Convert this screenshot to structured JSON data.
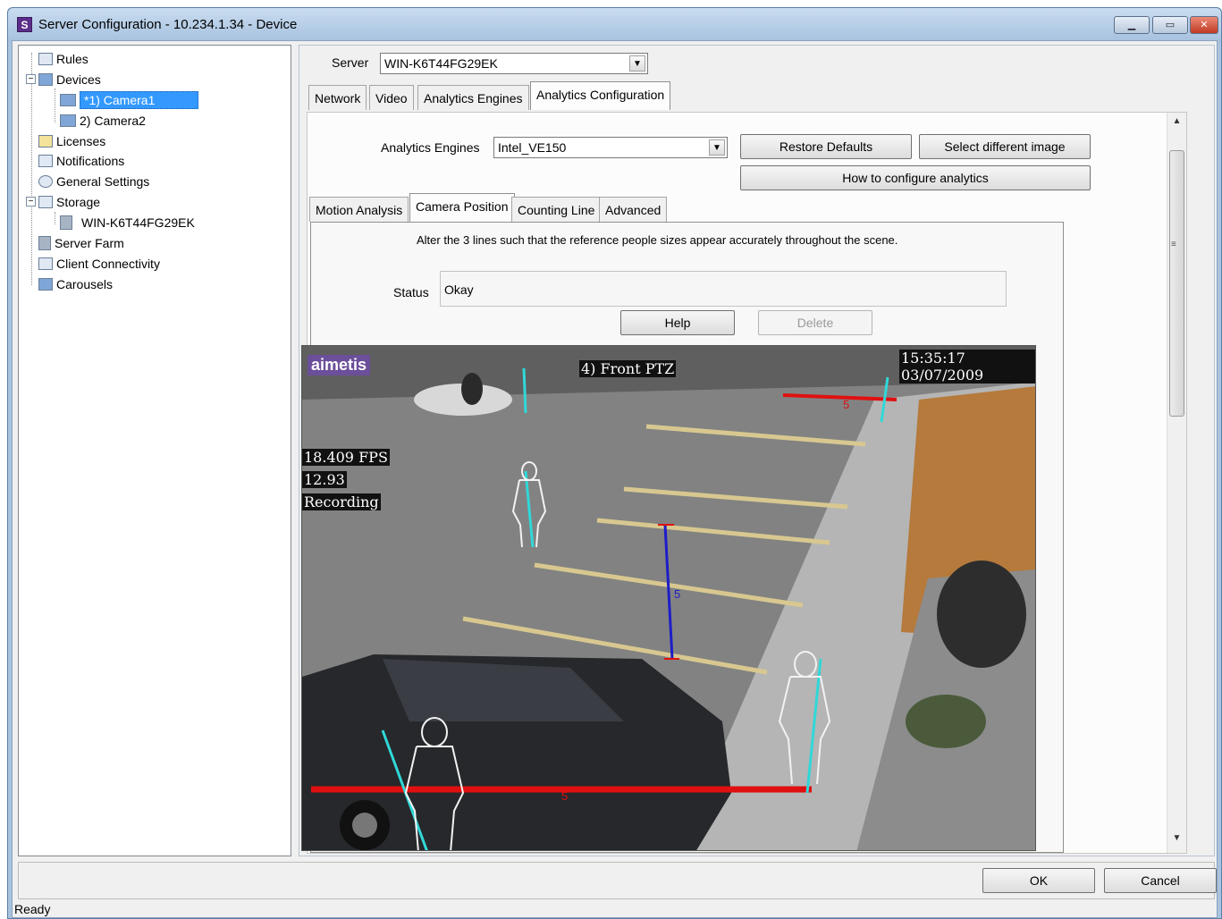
{
  "window": {
    "title": "Server Configuration - 10.234.1.34 - Device",
    "app_icon": "S",
    "min": "▁",
    "max": "▭",
    "close": "✕"
  },
  "tree": {
    "items": [
      {
        "label": "Rules"
      },
      {
        "label": "Devices"
      },
      {
        "label": "*1) Camera1"
      },
      {
        "label": "2) Camera2"
      },
      {
        "label": "Licenses"
      },
      {
        "label": "Notifications"
      },
      {
        "label": "General Settings"
      },
      {
        "label": "Storage"
      },
      {
        "label": "WIN-K6T44FG29EK"
      },
      {
        "label": "Server Farm"
      },
      {
        "label": "Client Connectivity"
      },
      {
        "label": "Carousels"
      }
    ],
    "expand_minus": "−"
  },
  "server": {
    "label": "Server",
    "value": "WIN-K6T44FG29EK"
  },
  "tabs": [
    "Network",
    "Video",
    "Analytics Engines",
    "Analytics Configuration"
  ],
  "analytics": {
    "engines_label": "Analytics Engines",
    "engine_value": "Intel_VE150",
    "restore_defaults": "Restore Defaults",
    "select_image": "Select different image",
    "how_to": "How to configure analytics"
  },
  "subtabs": [
    "Motion Analysis",
    "Camera Position",
    "Counting Line",
    "Advanced"
  ],
  "camera_position": {
    "instruction": "Alter the 3 lines such that the reference people sizes appear accurately throughout the scene.",
    "status_label": "Status",
    "status_value": "Okay",
    "help": "Help",
    "delete": "Delete"
  },
  "camera_image": {
    "logo": "aimetis",
    "camera_name": "4) Front PTZ",
    "timestamp": "15:35:17 03/07/2009",
    "fps": "18.409 FPS",
    "value": "12.93",
    "recording": "Recording",
    "line_label": "5"
  },
  "footer": {
    "ok": "OK",
    "cancel": "Cancel",
    "status": "Ready"
  },
  "icons": {
    "dropdown": "▼",
    "scroll_up": "▲",
    "scroll_down": "▼",
    "grip": "≡"
  },
  "colors": {
    "selection": "#3399ff",
    "reference_line_red": "#e01010",
    "reference_line_blue": "#1d1dc8",
    "figure_line_cyan": "#30d8d8"
  }
}
